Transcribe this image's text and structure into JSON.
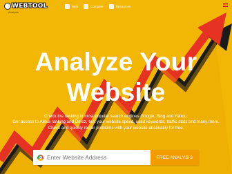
{
  "header": {
    "logo_text": "WEBTOOL",
    "logo_tagline": "Analysis",
    "nav": [
      {
        "icon": "home-icon",
        "label": "Web"
      },
      {
        "icon": "document-icon",
        "label": "Compare"
      },
      {
        "icon": "chart-icon",
        "label": "Resources"
      }
    ],
    "language_flag": "spanish-flag-icon"
  },
  "hero": {
    "title_line1": "Analyze Your",
    "title_line2": "Website",
    "description": [
      "Check the ranking in most popular search engines Google, Bing and Yahoo.",
      "Get access to Alexa ranking and Dmoz, test your website speed, used keywords, traffic stats and many more.",
      "Check and quickly repair problems with your website absolutely for free."
    ]
  },
  "search": {
    "placeholder": "Enter Website Address",
    "button_label": "FREE ANALYSIS"
  },
  "colors": {
    "background": "#f2b705",
    "arrow_red": "#e63222",
    "arrow_dark": "#1b1b1b",
    "button": "#f29c00"
  }
}
